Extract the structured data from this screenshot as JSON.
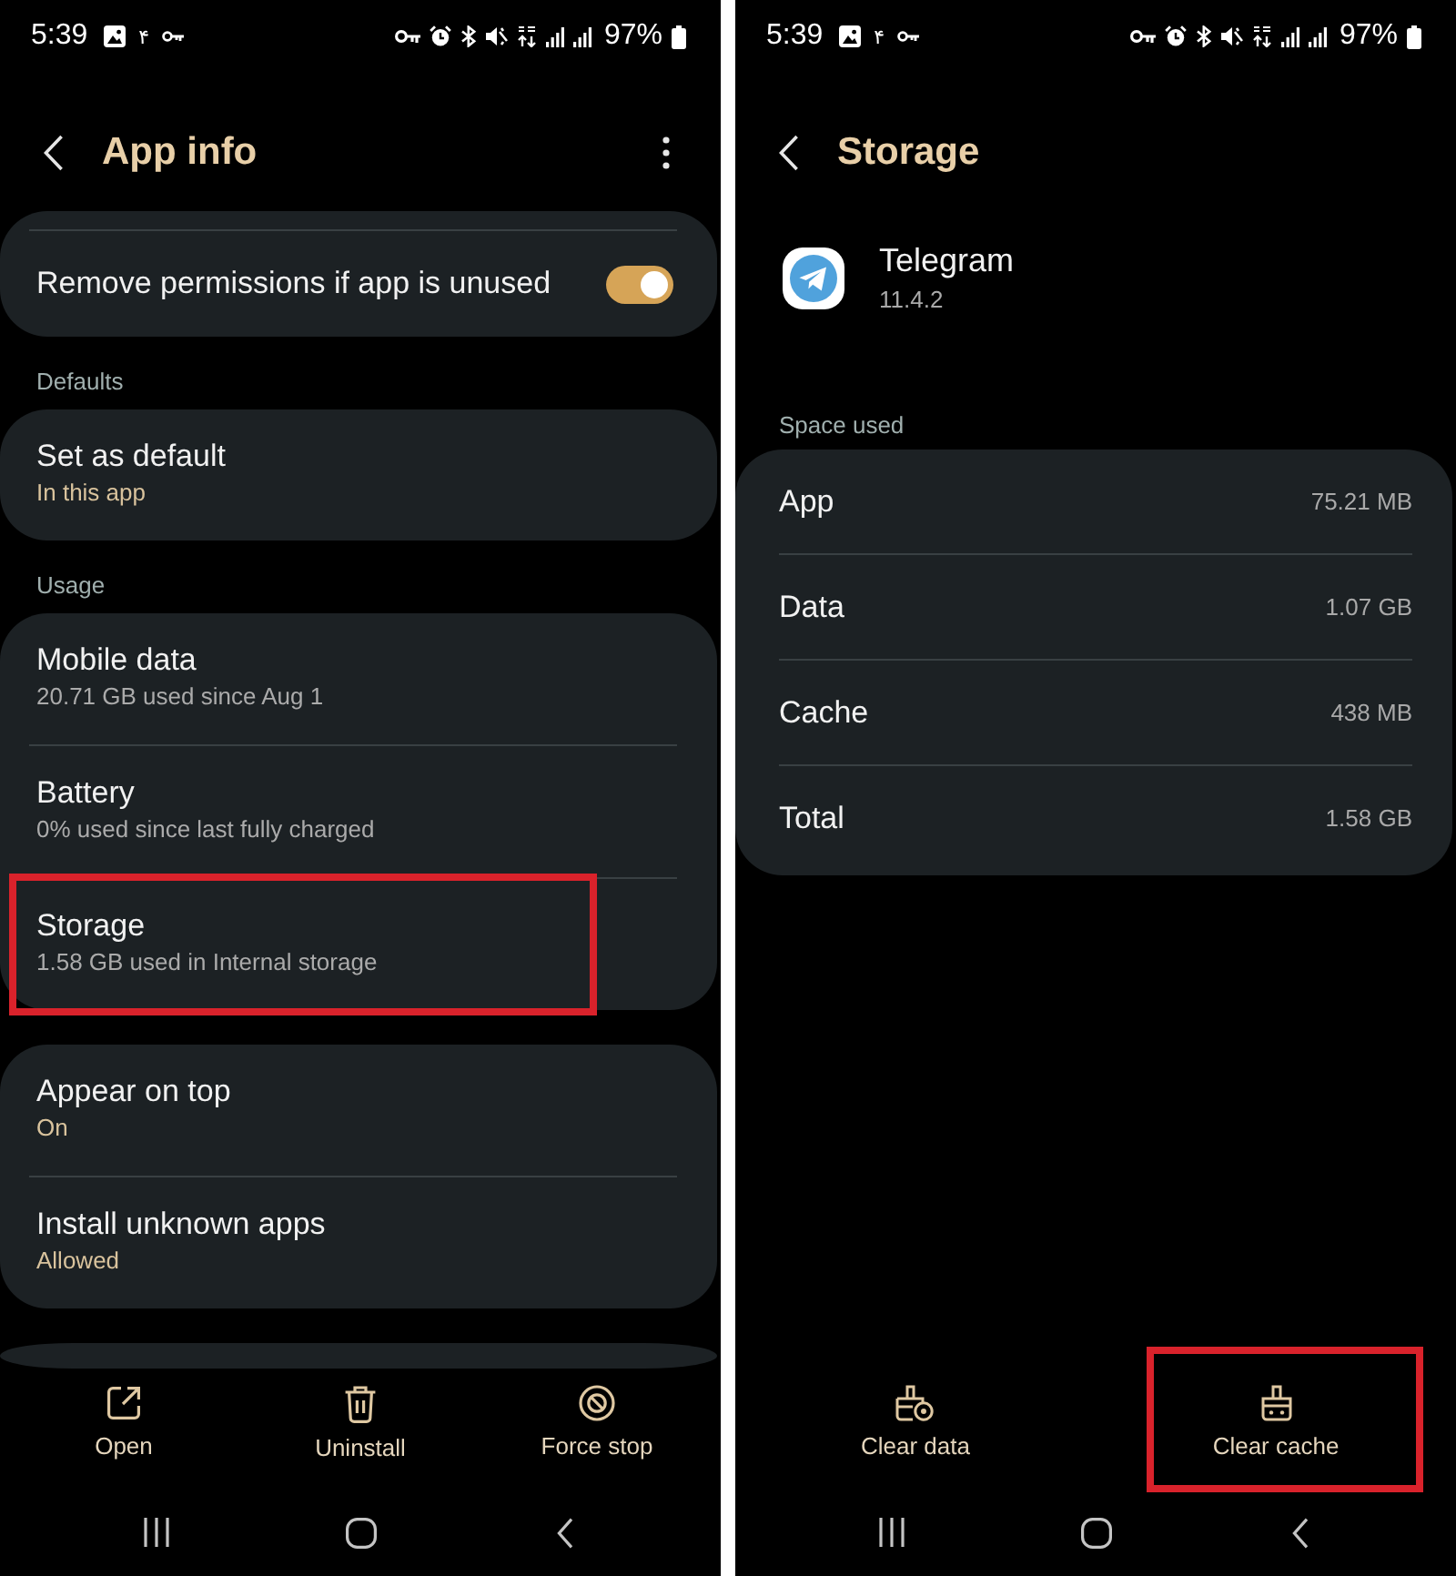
{
  "app_info_screen": {
    "status_bar": {
      "time": "5:39",
      "notification_text": "۴",
      "battery": "97%"
    },
    "title": "App info",
    "groups": [
      {
        "top_divider": true,
        "rows": [
          {
            "kind": "switch",
            "title": "Remove permissions if app is unused",
            "on": true,
            "highlighted": false
          }
        ]
      },
      {
        "label": "Defaults",
        "top_divider": false,
        "rows": [
          {
            "kind": "text",
            "title": "Set as default",
            "summary": "In this app",
            "summary_accent": true,
            "highlighted": false
          }
        ]
      },
      {
        "label": "Usage",
        "top_divider": false,
        "rows": [
          {
            "kind": "text",
            "title": "Mobile data",
            "summary": "20.71 GB used since Aug 1",
            "summary_accent": false,
            "highlighted": false
          },
          {
            "kind": "text",
            "title": "Battery",
            "summary": "0% used since last fully charged",
            "summary_accent": false,
            "highlighted": false
          },
          {
            "kind": "text",
            "title": "Storage",
            "summary": "1.58 GB used in Internal storage",
            "summary_accent": false,
            "highlighted": true
          }
        ]
      },
      {
        "top_divider": false,
        "rows": [
          {
            "kind": "text",
            "title": "Appear on top",
            "summary": "On",
            "summary_accent": true,
            "highlighted": false
          },
          {
            "kind": "text",
            "title": "Install unknown apps",
            "summary": "Allowed",
            "summary_accent": true,
            "highlighted": false
          }
        ]
      }
    ],
    "actions": [
      {
        "kind": "open",
        "label": "Open",
        "highlighted": false
      },
      {
        "kind": "uninstall",
        "label": "Uninstall",
        "highlighted": false
      },
      {
        "kind": "force_stop",
        "label": "Force stop",
        "highlighted": false
      }
    ]
  },
  "storage_screen": {
    "status_bar": {
      "time": "5:39",
      "notification_text": "۴",
      "battery": "97%"
    },
    "title": "Storage",
    "app": {
      "name": "Telegram",
      "version": "11.4.2"
    },
    "section_label": "Space used",
    "rows": [
      {
        "label": "App",
        "value": "75.21 MB"
      },
      {
        "label": "Data",
        "value": "1.07 GB"
      },
      {
        "label": "Cache",
        "value": "438 MB"
      },
      {
        "label": "Total",
        "value": "1.58 GB"
      }
    ],
    "actions": [
      {
        "kind": "clear_data",
        "label": "Clear data",
        "highlighted": false
      },
      {
        "kind": "clear_cache",
        "label": "Clear cache",
        "highlighted": true
      }
    ]
  }
}
